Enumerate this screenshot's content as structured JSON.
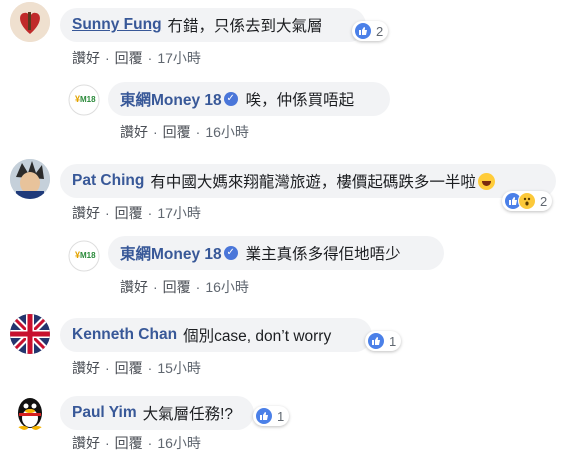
{
  "comments": [
    {
      "name": "Sunny Fung",
      "text": "冇錯，只係去到大氣層",
      "reaction_count": "2",
      "like_label": "讚好",
      "reply_label": "回覆",
      "time": "17小時",
      "reply": {
        "name": "東網Money 18",
        "text": "唉，仲係買唔起",
        "like_label": "讚好",
        "reply_label": "回覆",
        "time": "16小時"
      }
    },
    {
      "name": "Pat Ching",
      "text": "有中國大媽來翔龍灣旅遊，樓價起碼跌多一半啦",
      "reaction_count": "2",
      "like_label": "讚好",
      "reply_label": "回覆",
      "time": "17小時",
      "reply": {
        "name": "東網Money 18",
        "text": "業主真係多得佢地唔少",
        "like_label": "讚好",
        "reply_label": "回覆",
        "time": "16小時"
      }
    },
    {
      "name": "Kenneth Chan",
      "text": "個別case, don’t worry",
      "reaction_count": "1",
      "like_label": "讚好",
      "reply_label": "回覆",
      "time": "15小時"
    },
    {
      "name": "Paul Yim",
      "text": "大氣層任務!?",
      "reaction_count": "1",
      "like_label": "讚好",
      "reply_label": "回覆",
      "time": "16小時"
    }
  ],
  "icons": {
    "like": "thumbs-up-icon",
    "wow": "wow-face-icon",
    "verified": "verified-badge-icon"
  },
  "colors": {
    "name": "#385898",
    "bubble": "#f2f3f5",
    "like": "#4b80e8"
  }
}
